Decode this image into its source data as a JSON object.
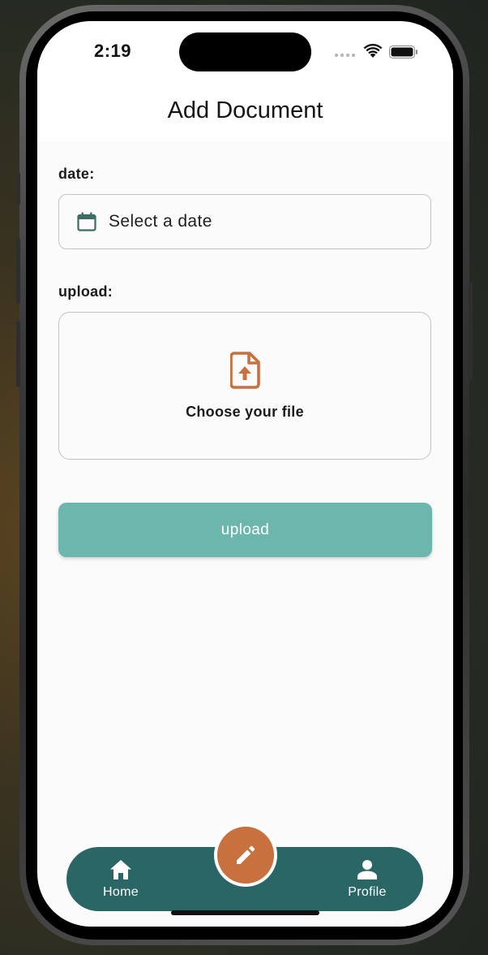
{
  "status_bar": {
    "time": "2:19"
  },
  "header": {
    "title": "Add Document"
  },
  "form": {
    "date_label": "date:",
    "date_placeholder": "Select a date",
    "upload_label": "upload:",
    "choose_file_text": "Choose your file",
    "upload_button_label": "upload"
  },
  "bottom_nav": {
    "items": [
      {
        "label": "Home",
        "icon": "home-icon"
      },
      {
        "label": "Profile",
        "icon": "person-icon"
      }
    ],
    "fab_icon": "pencil-icon"
  },
  "colors": {
    "teal_dark": "#2b6667",
    "teal_button": "#6db6ad",
    "accent_orange": "#c8703e",
    "calendar_icon": "#3d6b65"
  }
}
